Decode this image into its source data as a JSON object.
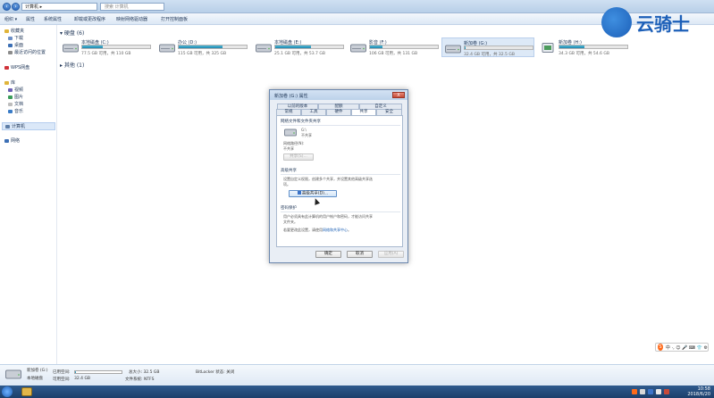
{
  "window": {
    "address": "计算机 ▸",
    "search_placeholder": "搜索 计算机"
  },
  "toolbar": {
    "items": [
      "组织 ▾",
      "属性",
      "系统属性",
      "卸载或更改程序",
      "映射网络驱动器",
      "打开控制面板"
    ]
  },
  "sidebar": {
    "items": [
      {
        "label": "收藏夹",
        "icon": "star-icon",
        "color": "#e0b43a"
      },
      {
        "label": "下载",
        "icon": "download-icon",
        "color": "#6c8fc7"
      },
      {
        "label": "桌面",
        "icon": "desktop-icon",
        "color": "#3c6fb5"
      },
      {
        "label": "最近访问的位置",
        "icon": "recent-icon",
        "color": "#8c8c8c"
      },
      {
        "label": "WPS网盘",
        "icon": "cloud-icon",
        "color": "#d0333a"
      },
      {
        "label": "库",
        "icon": "library-icon",
        "color": "#e0b43a"
      },
      {
        "label": "视频",
        "icon": "video-icon",
        "color": "#6a5fb5"
      },
      {
        "label": "图片",
        "icon": "picture-icon",
        "color": "#3a9c5a"
      },
      {
        "label": "文档",
        "icon": "document-icon",
        "color": "#d9d9d9"
      },
      {
        "label": "音乐",
        "icon": "music-icon",
        "color": "#3a7cc7"
      },
      {
        "label": "计算机",
        "icon": "computer-icon",
        "color": "#5f7fa8"
      },
      {
        "label": "网络",
        "icon": "network-icon",
        "color": "#3c6fb5"
      }
    ]
  },
  "main": {
    "group_disks": "▾ 硬盘 (6)",
    "group_other": "▸ 其他 (1)",
    "drives": [
      {
        "name": "本地磁盘 (C:)",
        "free": "77.5 GB 可用，共 110 GB",
        "used_fraction": 0.3
      },
      {
        "name": "办公 (D:)",
        "free": "115 GB 可用，共 325 GB",
        "used_fraction": 0.65
      },
      {
        "name": "本地磁盘 (E:)",
        "free": "25.1 GB 可用，共 53.7 GB",
        "used_fraction": 0.53
      },
      {
        "name": "影音 (F:)",
        "free": "106 GB 可用，共 131 GB",
        "used_fraction": 0.19
      },
      {
        "name": "新加卷 (G:)",
        "free": "32.4 GB 可用，共 32.5 GB",
        "used_fraction": 0.01
      },
      {
        "name": "新加卷 (H:)",
        "free": "34.3 GB 可用，共 54.6 GB",
        "used_fraction": 0.37
      }
    ]
  },
  "watermark": {
    "text": "云骑士"
  },
  "dialog": {
    "title": "新加卷 (G:) 属性",
    "close": "X",
    "tabs_row1": [
      "以前的版本",
      "配额",
      "自定义"
    ],
    "tabs_row2": [
      "常规",
      "工具",
      "硬件",
      "共享",
      "安全"
    ],
    "sec1_title": "网络文件和文件夹共享",
    "sec1_item": "G:\\",
    "sec1_item_sub": "不共享",
    "sec1_path_label": "网络路径(N):",
    "sec1_path_value": "不共享",
    "sec1_button": "共享(S)...",
    "sec2_title": "高级共享",
    "sec2_text1": "设置自定义权限，创建多个共享，并设置其他高级共享选",
    "sec2_text2": "项。",
    "sec2_button": "高级共享(D)...",
    "sec3_title": "密码保护",
    "sec3_text1": "用户必须具有此计算机的用户帐户和密码，才能访问共享",
    "sec3_text2": "文件夹。",
    "sec3_text3": "若要更改此设置，请使用",
    "sec3_link": "网络和共享中心",
    "sec3_text4": "。",
    "btn_ok": "确定",
    "btn_cancel": "取消",
    "btn_apply": "应用(A)"
  },
  "details": {
    "name": "新加卷 (G:)",
    "type": "本地磁盘",
    "used_label": "已用空间:",
    "free_label": "可用空间:",
    "free_value": "32.4 GB",
    "used_fraction": 0.01,
    "total_label": "总大小: 32.5 GB",
    "fs_label": "文件系统: NTFS",
    "bitlocker": "BitLocker 状态: 关闭"
  },
  "ime": {
    "label": "中 ·, ☺ 🎤 ⌨ 👕 ⚙"
  },
  "taskbar": {
    "time": "10:58",
    "date": "2018/6/20"
  }
}
